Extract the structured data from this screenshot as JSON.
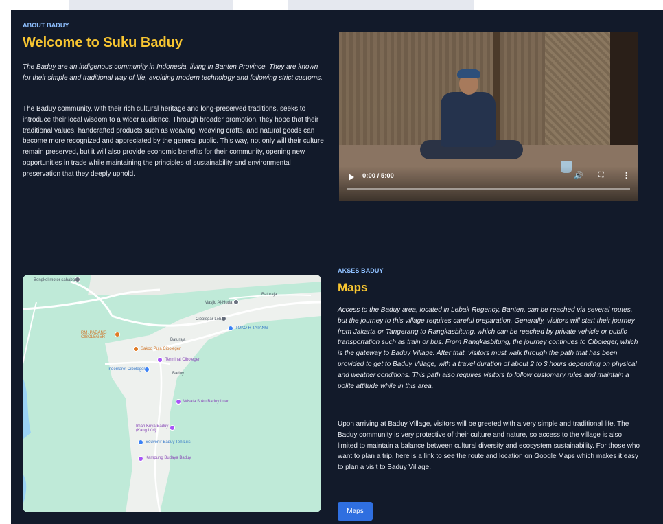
{
  "about": {
    "eyebrow": "ABOUT BADUY",
    "title": "Welcome to Suku Baduy",
    "intro": "The Baduy are an indigenous community in Indonesia, living in Banten Province. They are known for their simple and traditional way of life, avoiding modern technology and following strict customs.",
    "body": "The Baduy community, with their rich cultural heritage and long-preserved traditions, seeks to introduce their local wisdom to a wider audience. Through broader promotion, they hope that their traditional values, handcrafted products such as weaving, weaving crafts, and natural goods can become more recognized and appreciated by the general public. This way, not only will their culture remain preserved, but it will also provide economic benefits for their community, opening new opportunities in trade while maintaining the principles of sustainability and environmental preservation that they deeply uphold."
  },
  "video": {
    "time": "0:00 / 5:00",
    "progress": 0,
    "icons": [
      "play-icon",
      "volume-icon",
      "fullscreen-icon",
      "more-options-icon"
    ]
  },
  "access": {
    "eyebrow": "AKSES BADUY",
    "title": "Maps",
    "intro": "Access to the Baduy area, located in Lebak Regency, Banten, can be reached via several routes, but the journey to this village requires careful preparation. Generally, visitors will start their journey from Jakarta or Tangerang to Rangkasbitung, which can be reached by private vehicle or public transportation such as train or bus. From Rangkasbitung, the journey continues to Ciboleger, which is the gateway to Baduy Village. After that, visitors must walk through the path that has been provided to get to Baduy Village, with a travel duration of about 2 to 3 hours depending on physical and weather conditions. This path also requires visitors to follow customary rules and maintain a polite attitude while in this area.",
    "body": "Upon arriving at Baduy Village, visitors will be greeted with a very simple and traditional life. The Baduy community is very protective of their culture and nature, so access to the village is also limited to maintain a balance between cultural diversity and ecosystem sustainability. For those who want to plan a trip, here is a link to see the route and location on Google Maps which makes it easy to plan a visit to Baduy Village.",
    "button": "Maps"
  },
  "map": {
    "labels": {
      "bengkel": "Bengkel motor sahabat",
      "masjid": "Masjid Al-Huda",
      "ciboleger": "Cibolegar Lebak",
      "toko": "TOKO H TATANG",
      "rm_padang": "RM. PADANG CIBOLEGER",
      "sakoo": "Sakoo Puja Ciboleger",
      "terminal": "Terminal Ciboleger",
      "indomaret": "Indomaret Ciboleger",
      "wisata": "Wisata Suku Baduy Luar",
      "imah": "Imah Kriya Baduy (Kang Luri)",
      "souvenir": "Souvenir Baduy Teh Lilis",
      "kampung": "Kampung Budaya Baduy",
      "road1": "Baturaja",
      "road2": "Baturaja",
      "road3": "Baduy"
    },
    "colors": {
      "water": "#9bd3f5",
      "land": "#bfead8",
      "road": "#ffffff"
    }
  }
}
